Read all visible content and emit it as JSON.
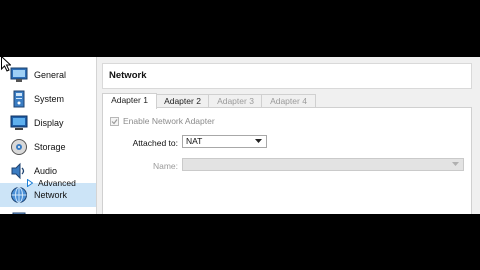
{
  "sidebar": {
    "items": [
      {
        "label": "General",
        "icon": "general-icon"
      },
      {
        "label": "System",
        "icon": "system-icon"
      },
      {
        "label": "Display",
        "icon": "display-icon"
      },
      {
        "label": "Storage",
        "icon": "storage-icon"
      },
      {
        "label": "Audio",
        "icon": "audio-icon"
      },
      {
        "label": "Network",
        "icon": "network-icon",
        "selected": true
      }
    ]
  },
  "header": {
    "title": "Network"
  },
  "tabs": [
    {
      "label": "Adapter 1",
      "active": true
    },
    {
      "label": "Adapter 2",
      "active": false
    },
    {
      "label": "Adapter 3",
      "disabled": true
    },
    {
      "label": "Adapter 4",
      "disabled": true
    }
  ],
  "adapter": {
    "enable_label": "Enable Network Adapter",
    "attached_label": "Attached to:",
    "attached_value": "NAT",
    "name_label": "Name:",
    "name_value": "",
    "advanced_label": "Advanced"
  },
  "colors": {
    "selection": "#cce4f7",
    "background": "#f0f0f0",
    "accent": "#1c7fd6"
  }
}
